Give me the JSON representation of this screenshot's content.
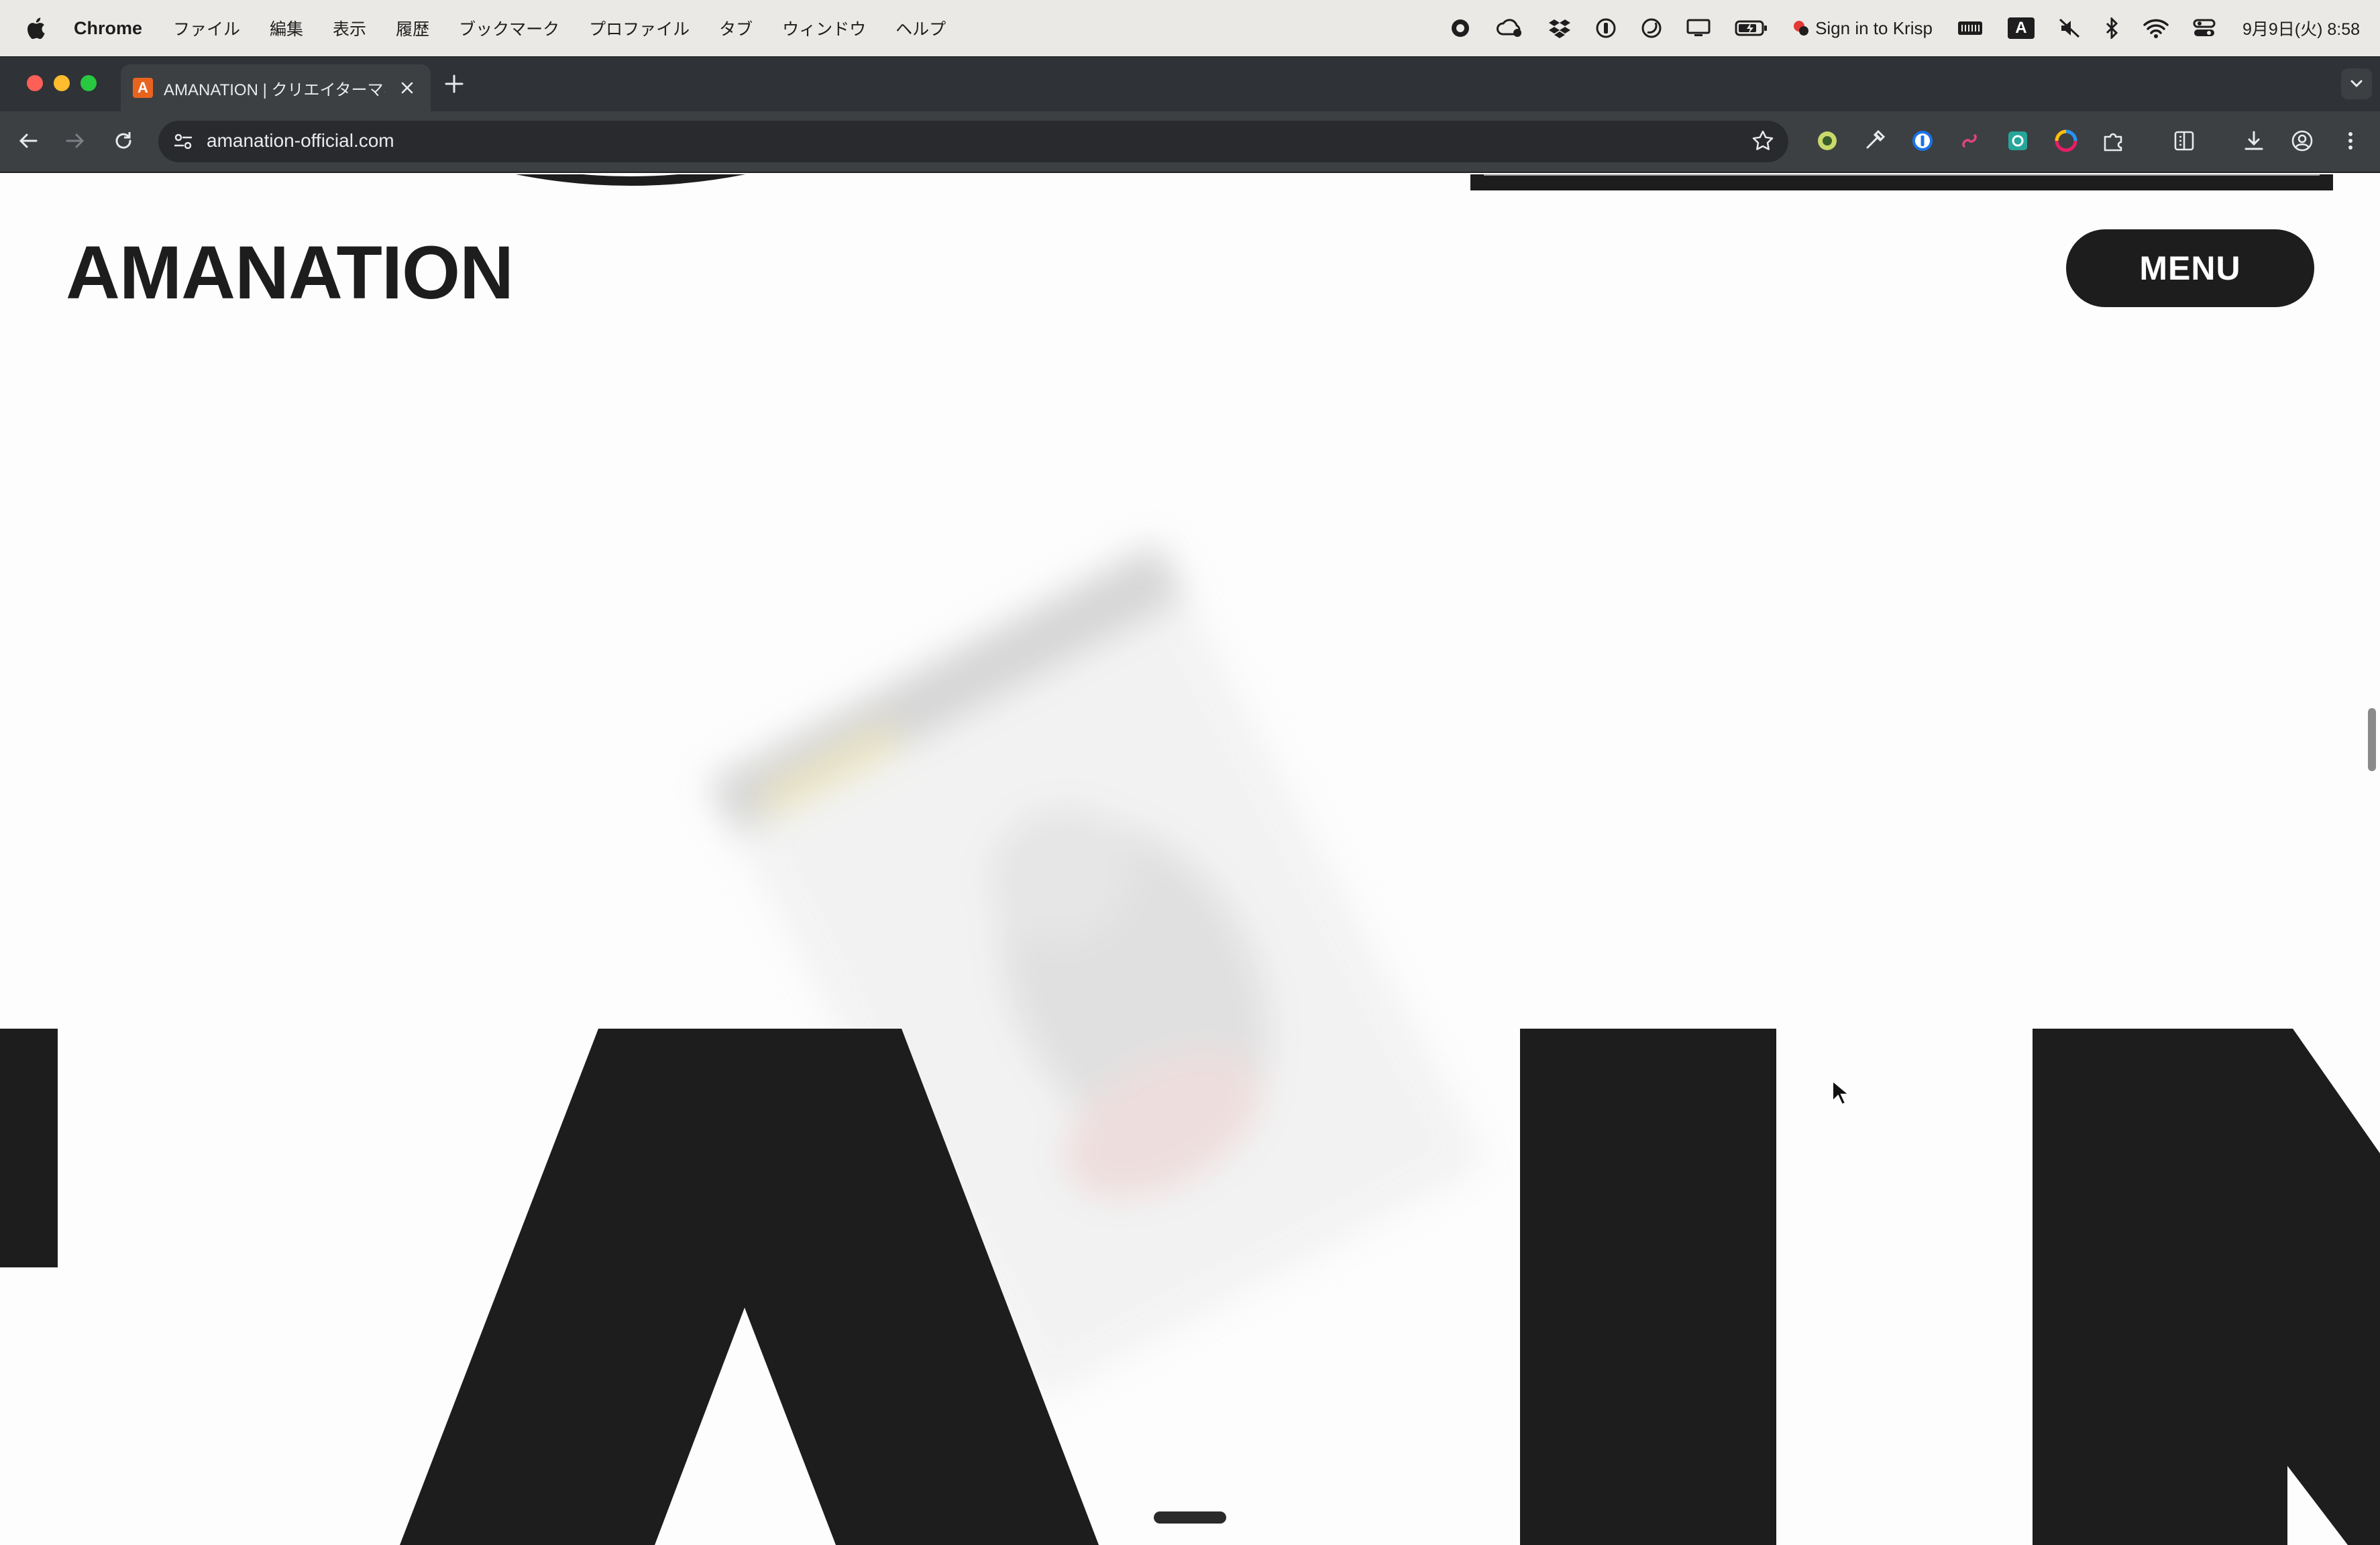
{
  "menubar": {
    "app_name": "Chrome",
    "items": [
      "ファイル",
      "編集",
      "表示",
      "履歴",
      "ブックマーク",
      "プロファイル",
      "タブ",
      "ウィンドウ",
      "ヘルプ"
    ],
    "krisp_label": "Sign in to Krisp",
    "input_mode": "A",
    "clock": "9月9日(火)  8:58"
  },
  "browser": {
    "tab_title": "AMANATION | クリエイターマネ",
    "tab_favicon_letter": "A",
    "url": "amanation-official.com"
  },
  "page": {
    "logo": "AMANATION",
    "menu_button": "MENU"
  },
  "colors": {
    "ink": "#1d1d1d",
    "page_bg": "#fdfdfd",
    "favicon": "#e8641e"
  }
}
